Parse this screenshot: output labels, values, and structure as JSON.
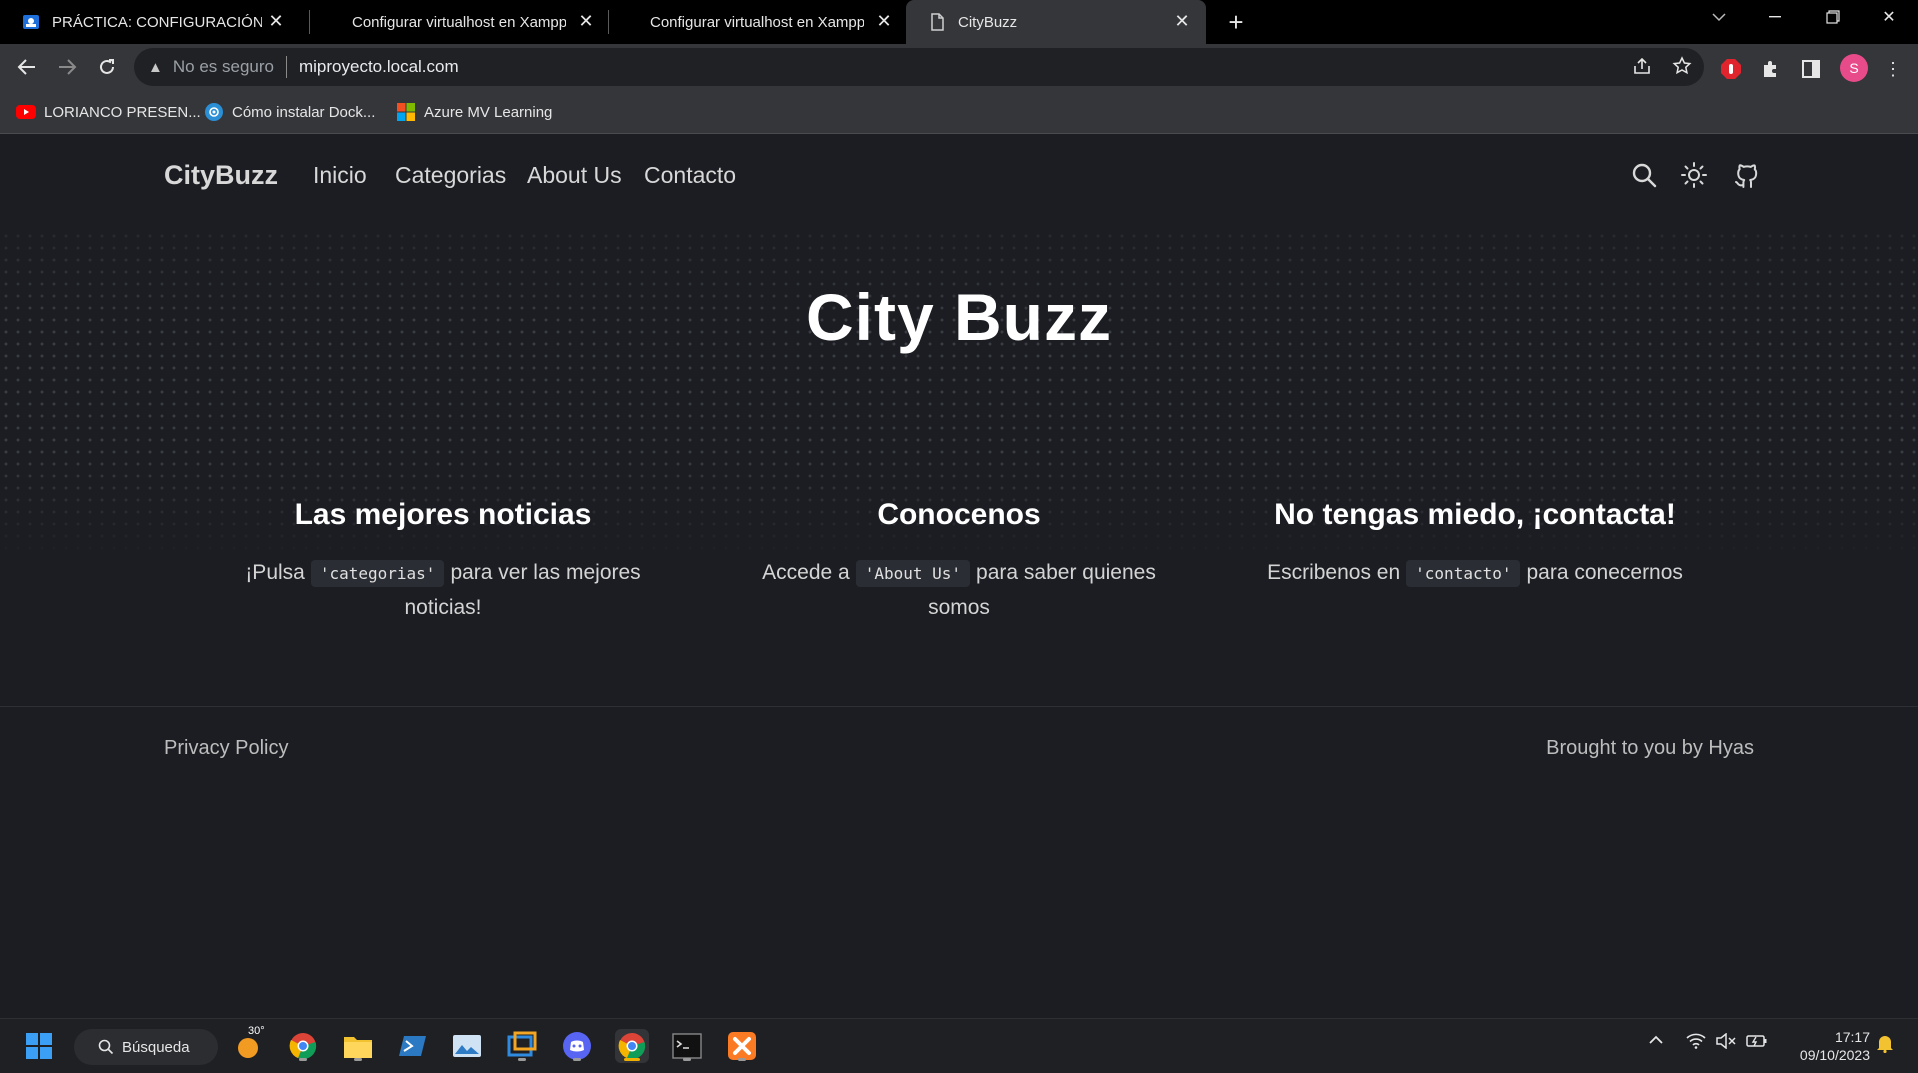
{
  "browser": {
    "tabs": [
      {
        "title": "PRÁCTICA: CONFIGURACIÓN VIRTUALHOST",
        "active": false
      },
      {
        "title": "Configurar virtualhost en Xampp",
        "active": false
      },
      {
        "title": "Configurar virtualhost en Xampp",
        "active": false
      },
      {
        "title": "CityBuzz",
        "active": true
      }
    ],
    "omnibox": {
      "security_label": "No es seguro",
      "url": "miproyecto.local.com"
    },
    "bookmarks": [
      {
        "label": "LORIANCO PRESEN..."
      },
      {
        "label": "Cómo instalar Dock..."
      },
      {
        "label": "Azure MV Learning"
      }
    ],
    "profile_initial": "S"
  },
  "site": {
    "brand": "CityBuzz",
    "nav": [
      "Inicio",
      "Categorias",
      "About Us",
      "Contacto"
    ],
    "hero_title": "City Buzz",
    "features": [
      {
        "title": "Las mejores noticias",
        "pre": "¡Pulsa",
        "code": "'categorias'",
        "post": "para ver las mejores noticias!"
      },
      {
        "title": "Conocenos",
        "pre": "Accede a",
        "code": "'About Us'",
        "post": "para saber quienes somos"
      },
      {
        "title": "No tengas miedo, ¡contacta!",
        "pre": "Escribenos en",
        "code": "'contacto'",
        "post": "para conecernos"
      }
    ],
    "footer_left": "Privacy Policy",
    "footer_right": "Brought to you by Hyas"
  },
  "taskbar": {
    "search_label": "Búsqueda",
    "weather_temp": "30°",
    "time": "17:17",
    "date": "09/10/2023"
  },
  "colors": {
    "page_bg": "#1b1d22",
    "chrome_bg": "#35363a",
    "tab_bar_bg": "#000000",
    "avatar": "#e84b8a"
  }
}
